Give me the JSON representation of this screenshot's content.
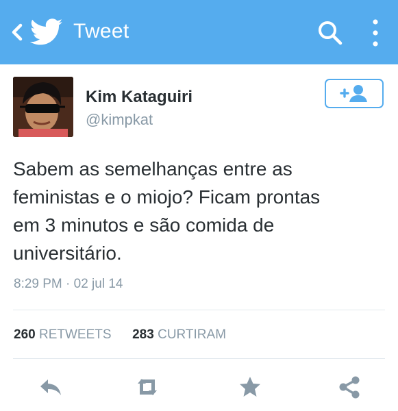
{
  "app": {
    "title": "Tweet",
    "accent_color": "#55acee"
  },
  "toolbar": {
    "back_icon": "chevron-left-icon",
    "logo_icon": "twitter-bird-icon",
    "search_icon": "search-icon",
    "more_icon": "vertical-ellipsis-icon"
  },
  "author": {
    "name": "Kim Kataguiri",
    "handle": "@kimpkat"
  },
  "follow_button": {
    "icon": "add-user-icon"
  },
  "tweet": {
    "lines": [
      "Sabem as semelhanças entre as",
      "feministas e o miojo? Ficam prontas",
      "em 3 minutos e são comida de",
      "universitário."
    ],
    "timestamp": "8:29 PM · 02 jul 14"
  },
  "stats": {
    "retweets_count": "260",
    "retweets_label": "RETWEETS",
    "likes_count": "283",
    "likes_label": "CURTIRAM"
  },
  "actions": [
    {
      "icon": "reply-icon"
    },
    {
      "icon": "retweet-icon"
    },
    {
      "icon": "star-icon"
    },
    {
      "icon": "share-icon"
    }
  ]
}
